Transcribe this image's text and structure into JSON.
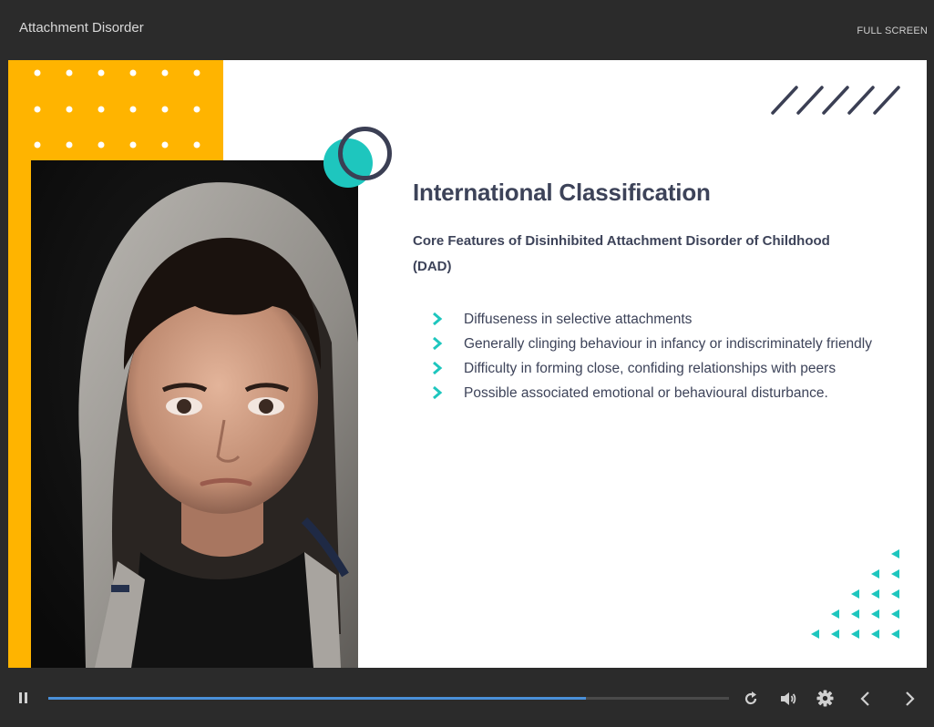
{
  "app": {
    "title": "Attachment Disorder",
    "fullscreen_label": "FULL SCREEN"
  },
  "slide": {
    "title": "International Classification",
    "subtitle": "Core Features of Disinhibited Attachment Disorder of Childhood (DAD)",
    "bullets": [
      "Diffuseness in selective attachments",
      "Generally clinging behaviour in infancy or indiscriminately friendly",
      "Difficulty in forming close, confiding relationships with peers",
      "Possible associated emotional or behavioural disturbance."
    ],
    "image": "boy-in-grey-hoodie-photo"
  },
  "player": {
    "progress": 0.79,
    "icons": [
      "pause-icon",
      "replay-icon",
      "volume-icon",
      "settings-icon",
      "previous-icon",
      "next-icon"
    ]
  },
  "colors": {
    "accent_yellow": "#ffb400",
    "accent_teal": "#1ec6be",
    "text_navy": "#3d4359",
    "progress_blue": "#4a90d9",
    "chrome_dark": "#2b2b2b"
  }
}
